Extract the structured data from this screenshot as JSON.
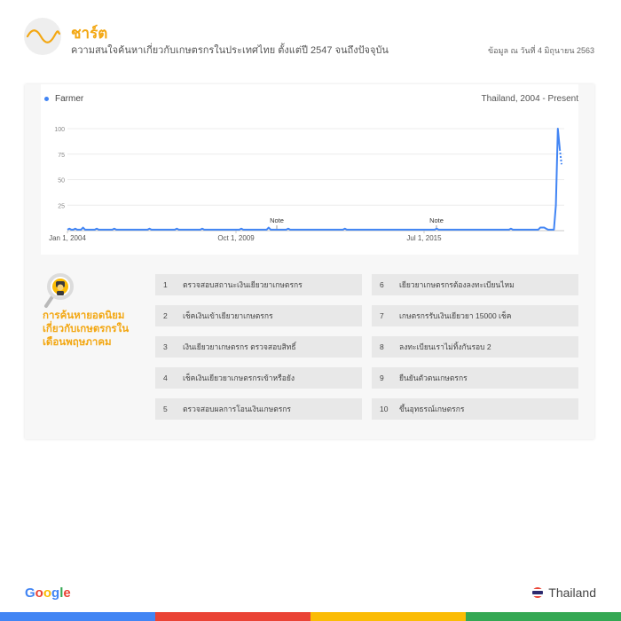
{
  "header": {
    "title": "ชาร์ต",
    "subtitle": "ความสนใจค้นหาเกี่ยวกับเกษตรกรในประเทศไทย ตั้งแต่ปี 2547 จนถึงปัจจุบัน",
    "date": "ข้อมูล ณ วันที่ 4 มิถุนายน 2563"
  },
  "chart": {
    "legend": "Farmer",
    "region": "Thailand, 2004 - Present",
    "series_color": "#4285f4",
    "notes": [
      "Note",
      "Note"
    ]
  },
  "chart_data": {
    "type": "line",
    "x_labels": [
      "Jan 1, 2004",
      "Oct 1, 2009",
      "Jul 1, 2015"
    ],
    "y_ticks": [
      25,
      50,
      75,
      100
    ],
    "ylim": [
      0,
      100
    ],
    "grid": true,
    "series": [
      {
        "name": "Farmer",
        "values": [
          1,
          2,
          1,
          1,
          2,
          1,
          1,
          1,
          3,
          1,
          1,
          1,
          1,
          1,
          1,
          2,
          1,
          1,
          1,
          1,
          1,
          1,
          1,
          1,
          2,
          1,
          1,
          1,
          1,
          1,
          1,
          1,
          1,
          1,
          1,
          1,
          1,
          1,
          1,
          1,
          1,
          1,
          2,
          1,
          1,
          1,
          1,
          1,
          1,
          1,
          1,
          1,
          1,
          1,
          1,
          1,
          2,
          1,
          1,
          1,
          1,
          1,
          1,
          1,
          1,
          1,
          1,
          1,
          1,
          2,
          1,
          1,
          1,
          1,
          1,
          1,
          1,
          1,
          1,
          1,
          1,
          1,
          1,
          1,
          1,
          1,
          1,
          1,
          1,
          2,
          1,
          1,
          1,
          1,
          1,
          1,
          1,
          1,
          1,
          1,
          1,
          1,
          1,
          3,
          1,
          1,
          1,
          1,
          1,
          1,
          1,
          1,
          1,
          2,
          1,
          1,
          1,
          1,
          1,
          1,
          1,
          1,
          1,
          1,
          1,
          1,
          1,
          1,
          1,
          1,
          1,
          1,
          1,
          1,
          1,
          1,
          1,
          1,
          1,
          1,
          1,
          1,
          2,
          1,
          1,
          1,
          1,
          1,
          1,
          1,
          1,
          1,
          1,
          1,
          1,
          1,
          1,
          1,
          1,
          1,
          1,
          1,
          1,
          1,
          1,
          1,
          1,
          1,
          1,
          1,
          1,
          1,
          1,
          1,
          1,
          1,
          1,
          1,
          1,
          1,
          1,
          1,
          1,
          1,
          1,
          1,
          1,
          1,
          1,
          2,
          1,
          1,
          1,
          1,
          1,
          1,
          1,
          1,
          1,
          1,
          1,
          1,
          1,
          1,
          1,
          1,
          1,
          1,
          1,
          1,
          1,
          1,
          1,
          1,
          1,
          1,
          1,
          1,
          1,
          1,
          1,
          1,
          1,
          1,
          1,
          1,
          1,
          2,
          1,
          1,
          1,
          1,
          1,
          1,
          1,
          1,
          1,
          1,
          1,
          1,
          1,
          1,
          3,
          3,
          3,
          2,
          1,
          1,
          1,
          1,
          25,
          100,
          80
        ]
      }
    ],
    "partial_tail": [
      80,
      65
    ]
  },
  "popular": {
    "title": "การค้นหายอดนิยมเกี่ยวกับเกษตรกรในเดือนพฤษภาคม",
    "items": [
      {
        "rank": "1",
        "text": "ตรวจสอบสถานะเงินเยียวยาเกษตรกร"
      },
      {
        "rank": "2",
        "text": "เช็คเงินเข้าเยียวยาเกษตรกร"
      },
      {
        "rank": "3",
        "text": "เงินเยียวยาเกษตรกร ตรวจสอบสิทธิ์"
      },
      {
        "rank": "4",
        "text": "เช็คเงินเยียวยาเกษตรกรเข้าหรือยัง"
      },
      {
        "rank": "5",
        "text": "ตรวจสอบผลการโอนเงินเกษตรกร"
      },
      {
        "rank": "6",
        "text": "เยียวยาเกษตรกรต้องลงทะเบียนไหม"
      },
      {
        "rank": "7",
        "text": "เกษตรกรรับเงินเยียวยา 15000 เช็ค"
      },
      {
        "rank": "8",
        "text": "ลงทะเบียนเราไม่ทิ้งกันรอบ 2"
      },
      {
        "rank": "9",
        "text": "ยืนยันตัวตนเกษตรกร"
      },
      {
        "rank": "10",
        "text": "ขึ้นอุทธรณ์เกษตรกร"
      }
    ]
  },
  "footer": {
    "brand_letters": [
      "G",
      "o",
      "o",
      "g",
      "l",
      "e"
    ],
    "brand_colors": [
      "#4285f4",
      "#ea4335",
      "#fbbc05",
      "#4285f4",
      "#34a853",
      "#ea4335"
    ],
    "country": "Thailand",
    "bar_colors": [
      "#4285f4",
      "#ea4335",
      "#fbbc05",
      "#34a853"
    ]
  }
}
